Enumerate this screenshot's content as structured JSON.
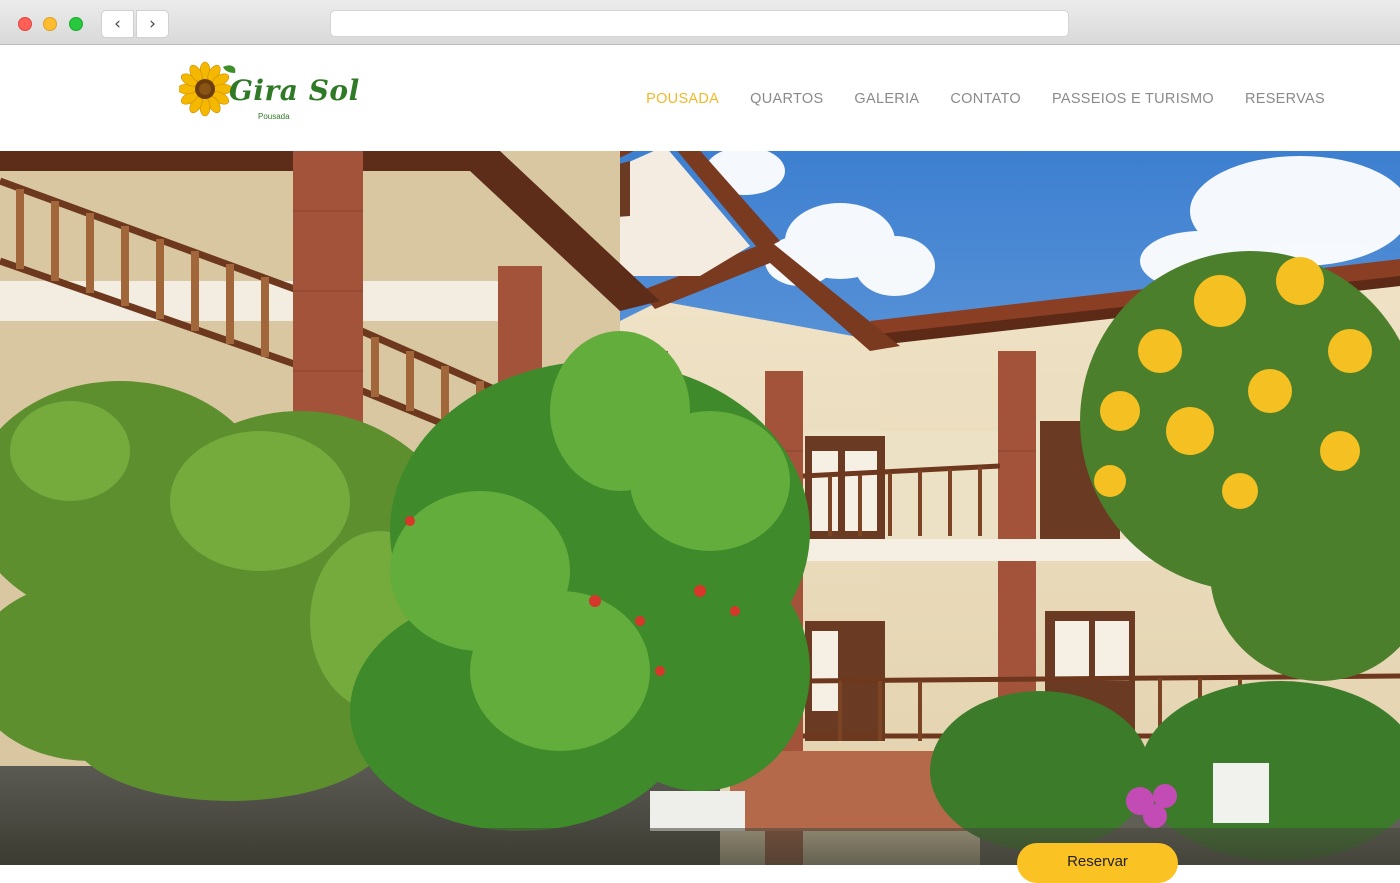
{
  "browser": {
    "back_icon": "chevron-left-icon",
    "forward_icon": "chevron-right-icon",
    "back_glyph": "‹",
    "forward_glyph": "›"
  },
  "site": {
    "logo": {
      "name": "Gira Sol",
      "subtitle": "Pousada",
      "icon": "sunflower-icon"
    },
    "nav": [
      {
        "label": "POUSADA",
        "active": true
      },
      {
        "label": "QUARTOS",
        "active": false
      },
      {
        "label": "GALERIA",
        "active": false
      },
      {
        "label": "CONTATO",
        "active": false
      },
      {
        "label": "PASSEIOS E TURISMO",
        "active": false
      },
      {
        "label": "RESERVAS",
        "active": false
      }
    ]
  },
  "hero": {
    "image": "pousada-building-photo",
    "cta_label": "Reservar"
  },
  "colors": {
    "accent": "#f0b92a",
    "button": "#fbc223",
    "brand_green": "#2f7a26",
    "nav_text": "#8a8a8a"
  }
}
